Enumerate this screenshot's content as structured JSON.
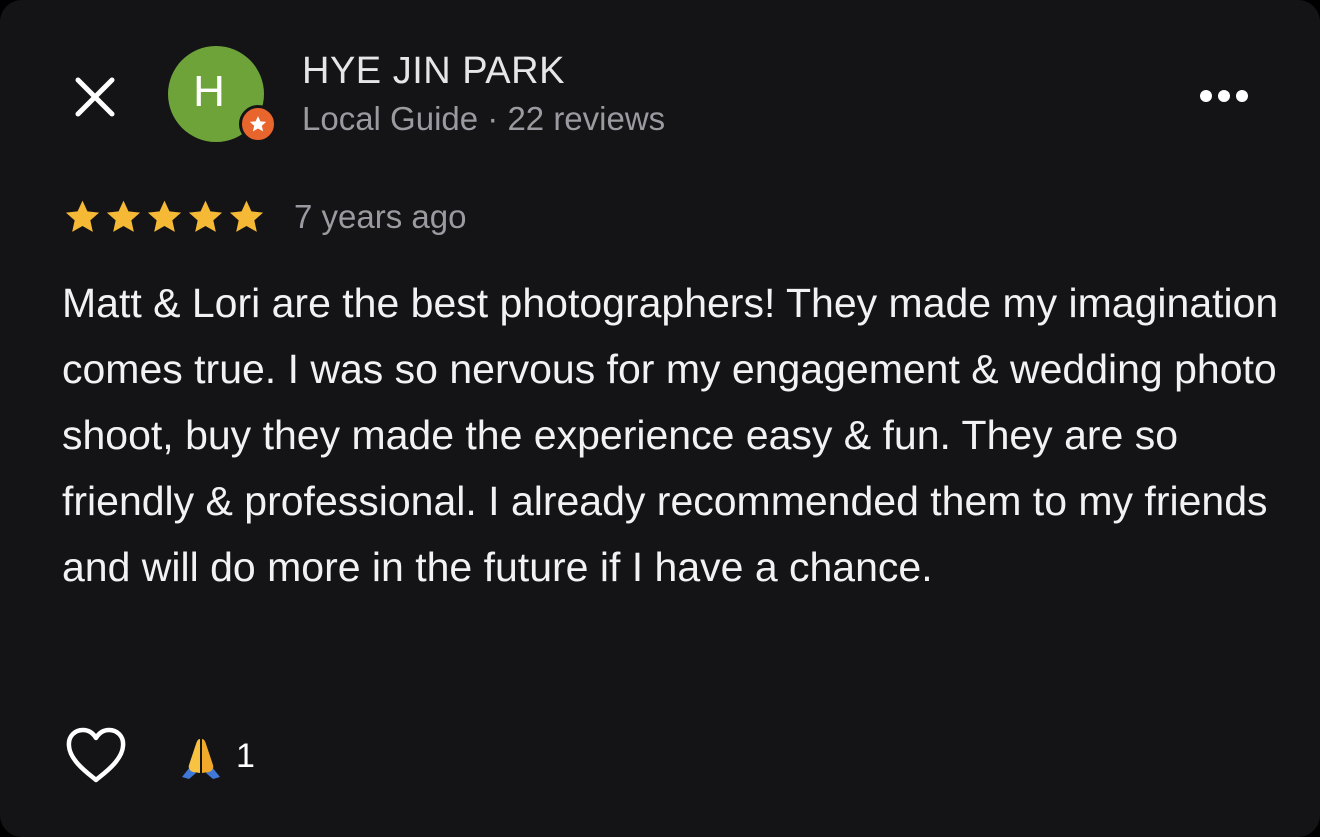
{
  "header": {
    "close_icon": "close-icon",
    "more_icon": "more-horizontal-icon"
  },
  "reviewer": {
    "avatar_letter": "H",
    "avatar_color": "#6ea33a",
    "badge_color": "#e8652e",
    "badge_icon": "local-guide-star-icon",
    "name": "HYE JIN PARK",
    "meta": "Local Guide · 22 reviews"
  },
  "rating": {
    "stars": 5,
    "max_stars": 5,
    "star_color": "#f6b936",
    "time_ago": "7 years ago"
  },
  "review": {
    "text": "Matt & Lori are the best photographers! They made my imagination comes true. I was so nervous for my engagement & wedding photo shoot, buy they made the experience easy & fun. They are so friendly & professional. I already recommended them to my friends and will do more in the future if I have a chance."
  },
  "actions": {
    "like_icon": "heart-outline-icon",
    "reaction_emoji": "🙏",
    "reaction_icon": "folded-hands-icon",
    "reaction_count": "1"
  },
  "colors": {
    "background": "#141416",
    "primary_text": "#f2f2f4",
    "secondary_text": "#9a9aa0"
  }
}
